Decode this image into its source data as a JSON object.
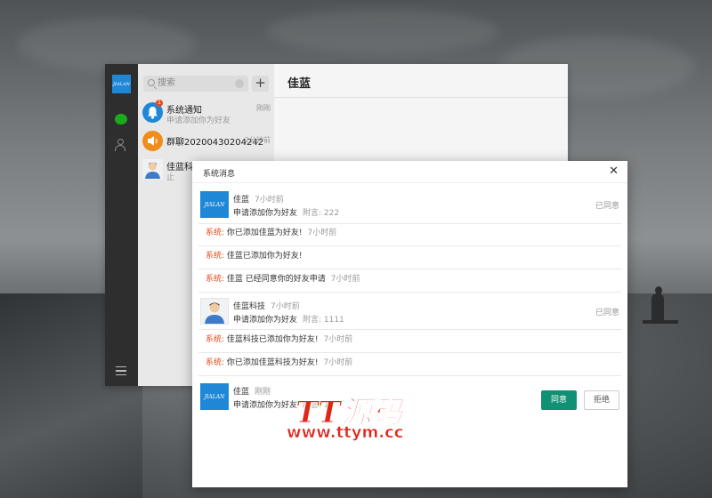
{
  "chat": {
    "search_placeholder": "搜索",
    "add_label": "+",
    "conversations": [
      {
        "name": "系统通知",
        "sub": "申请添加你为好友",
        "time": "刚刚",
        "badge": "1"
      },
      {
        "name": "群聊20200430204242",
        "sub": "",
        "time": "2分钟前"
      },
      {
        "name": "佳蓝科技",
        "sub": "止",
        "time": ""
      }
    ],
    "current_title": "佳蓝"
  },
  "modal": {
    "title": "系统消息",
    "close": "✕",
    "requests": [
      {
        "name": "佳蓝",
        "time": "7小时前",
        "desc": "申请添加你为好友",
        "extra": "附言: 222",
        "status": "已同意"
      },
      {
        "name": "佳蓝科技",
        "time": "7小时前",
        "desc": "申请添加你为好友",
        "extra": "附言: 1111",
        "status": "已同意"
      },
      {
        "name": "佳蓝",
        "time": "刚刚",
        "desc": "申请添加你为好友",
        "extra": "附言: 1",
        "agree": "同意",
        "reject": "拒绝"
      }
    ],
    "system_label": "系统:",
    "system_messages": [
      {
        "text": "你已添加佳蓝为好友!",
        "time": "7小时前"
      },
      {
        "text": "佳蓝已添加你为好友!",
        "time": ""
      },
      {
        "text": "佳蓝 已经同意你的好友申请",
        "time": "7小时前"
      },
      {
        "text": "佳蓝科技已添加你为好友!",
        "time": "7小时前"
      },
      {
        "text": "你已添加佳蓝科技为好友!",
        "time": "7小时前"
      }
    ]
  },
  "watermark": {
    "big": "TT源码",
    "url": "www.ttym.cc"
  },
  "colors": {
    "accent": "#109173",
    "system_label": "#e64a19",
    "brand_blue": "#1e88d7"
  },
  "icons": [
    "logo-icon",
    "chat-icon",
    "contacts-icon",
    "menu-icon",
    "search-icon",
    "clear-icon",
    "bell-icon",
    "speaker-icon",
    "close-icon"
  ]
}
